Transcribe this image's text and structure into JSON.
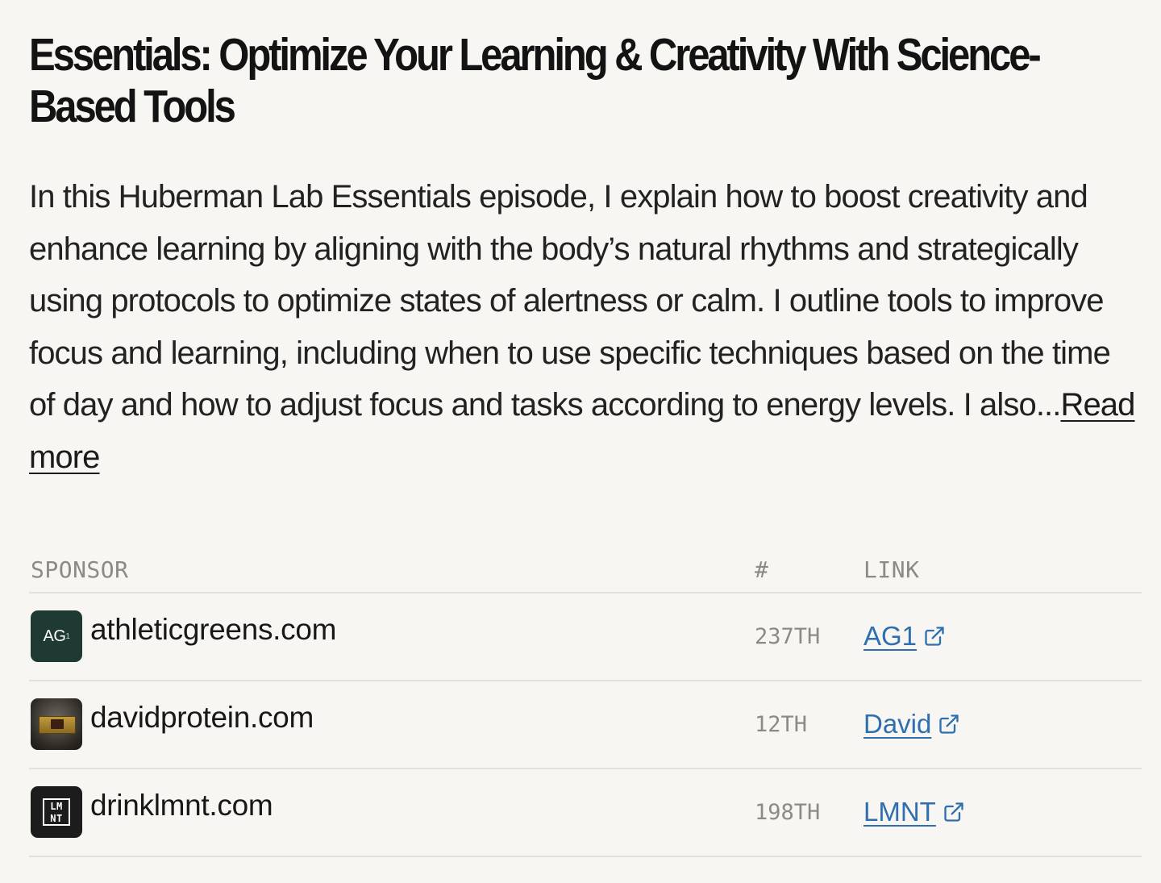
{
  "episode": {
    "title": "Essentials: Optimize Your Learning & Creativity With Science-Based Tools",
    "description": "In this Huberman Lab Essentials episode, I explain how to boost creativity and enhance learning by aligning with the body’s natural rhythms and strategically using protocols to optimize states of alertness or calm. I outline tools to improve focus and learning, including when to use specific techniques based on the time of day and how to adjust focus and tasks according to energy levels. I also...",
    "read_more_label": "Read more"
  },
  "sponsors": {
    "headers": {
      "sponsor": "SPONSOR",
      "rank": "#",
      "link": "LINK"
    },
    "rows": [
      {
        "logo_icon": "ag1-logo-icon",
        "logo_text": "AG",
        "domain": "athleticgreens.com",
        "rank": "237TH",
        "link_label": "AG1"
      },
      {
        "logo_icon": "david-protein-logo-icon",
        "domain": "davidprotein.com",
        "rank": "12TH",
        "link_label": "David"
      },
      {
        "logo_icon": "lmnt-logo-icon",
        "logo_text_top": "LM",
        "logo_text_bottom": "NT",
        "domain": "drinklmnt.com",
        "rank": "198TH",
        "link_label": "LMNT"
      }
    ]
  },
  "colors": {
    "background": "#f7f6f2",
    "link": "#2f6fb0",
    "muted": "#8a8a87",
    "divider": "#e3e2de"
  }
}
